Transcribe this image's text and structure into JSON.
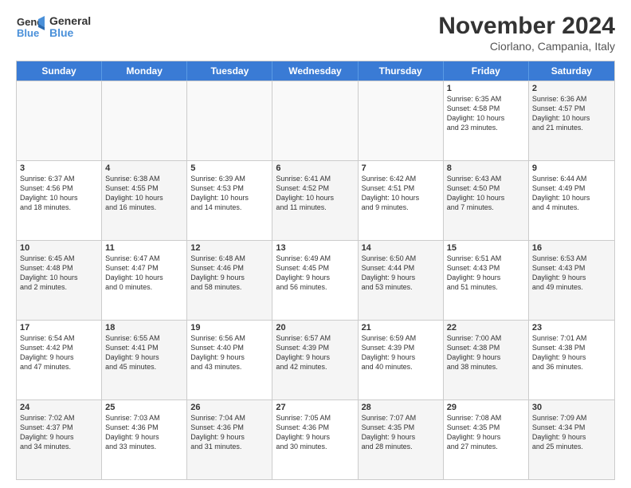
{
  "logo": {
    "text_general": "General",
    "text_blue": "Blue"
  },
  "title": "November 2024",
  "subtitle": "Ciorlano, Campania, Italy",
  "headers": [
    "Sunday",
    "Monday",
    "Tuesday",
    "Wednesday",
    "Thursday",
    "Friday",
    "Saturday"
  ],
  "rows": [
    [
      {
        "day": "",
        "info": "",
        "empty": true
      },
      {
        "day": "",
        "info": "",
        "empty": true
      },
      {
        "day": "",
        "info": "",
        "empty": true
      },
      {
        "day": "",
        "info": "",
        "empty": true
      },
      {
        "day": "",
        "info": "",
        "empty": true
      },
      {
        "day": "1",
        "info": "Sunrise: 6:35 AM\nSunset: 4:58 PM\nDaylight: 10 hours\nand 23 minutes."
      },
      {
        "day": "2",
        "info": "Sunrise: 6:36 AM\nSunset: 4:57 PM\nDaylight: 10 hours\nand 21 minutes.",
        "shaded": true
      }
    ],
    [
      {
        "day": "3",
        "info": "Sunrise: 6:37 AM\nSunset: 4:56 PM\nDaylight: 10 hours\nand 18 minutes."
      },
      {
        "day": "4",
        "info": "Sunrise: 6:38 AM\nSunset: 4:55 PM\nDaylight: 10 hours\nand 16 minutes.",
        "shaded": true
      },
      {
        "day": "5",
        "info": "Sunrise: 6:39 AM\nSunset: 4:53 PM\nDaylight: 10 hours\nand 14 minutes."
      },
      {
        "day": "6",
        "info": "Sunrise: 6:41 AM\nSunset: 4:52 PM\nDaylight: 10 hours\nand 11 minutes.",
        "shaded": true
      },
      {
        "day": "7",
        "info": "Sunrise: 6:42 AM\nSunset: 4:51 PM\nDaylight: 10 hours\nand 9 minutes."
      },
      {
        "day": "8",
        "info": "Sunrise: 6:43 AM\nSunset: 4:50 PM\nDaylight: 10 hours\nand 7 minutes.",
        "shaded": true
      },
      {
        "day": "9",
        "info": "Sunrise: 6:44 AM\nSunset: 4:49 PM\nDaylight: 10 hours\nand 4 minutes."
      }
    ],
    [
      {
        "day": "10",
        "info": "Sunrise: 6:45 AM\nSunset: 4:48 PM\nDaylight: 10 hours\nand 2 minutes.",
        "shaded": true
      },
      {
        "day": "11",
        "info": "Sunrise: 6:47 AM\nSunset: 4:47 PM\nDaylight: 10 hours\nand 0 minutes."
      },
      {
        "day": "12",
        "info": "Sunrise: 6:48 AM\nSunset: 4:46 PM\nDaylight: 9 hours\nand 58 minutes.",
        "shaded": true
      },
      {
        "day": "13",
        "info": "Sunrise: 6:49 AM\nSunset: 4:45 PM\nDaylight: 9 hours\nand 56 minutes."
      },
      {
        "day": "14",
        "info": "Sunrise: 6:50 AM\nSunset: 4:44 PM\nDaylight: 9 hours\nand 53 minutes.",
        "shaded": true
      },
      {
        "day": "15",
        "info": "Sunrise: 6:51 AM\nSunset: 4:43 PM\nDaylight: 9 hours\nand 51 minutes."
      },
      {
        "day": "16",
        "info": "Sunrise: 6:53 AM\nSunset: 4:43 PM\nDaylight: 9 hours\nand 49 minutes.",
        "shaded": true
      }
    ],
    [
      {
        "day": "17",
        "info": "Sunrise: 6:54 AM\nSunset: 4:42 PM\nDaylight: 9 hours\nand 47 minutes."
      },
      {
        "day": "18",
        "info": "Sunrise: 6:55 AM\nSunset: 4:41 PM\nDaylight: 9 hours\nand 45 minutes.",
        "shaded": true
      },
      {
        "day": "19",
        "info": "Sunrise: 6:56 AM\nSunset: 4:40 PM\nDaylight: 9 hours\nand 43 minutes."
      },
      {
        "day": "20",
        "info": "Sunrise: 6:57 AM\nSunset: 4:39 PM\nDaylight: 9 hours\nand 42 minutes.",
        "shaded": true
      },
      {
        "day": "21",
        "info": "Sunrise: 6:59 AM\nSunset: 4:39 PM\nDaylight: 9 hours\nand 40 minutes."
      },
      {
        "day": "22",
        "info": "Sunrise: 7:00 AM\nSunset: 4:38 PM\nDaylight: 9 hours\nand 38 minutes.",
        "shaded": true
      },
      {
        "day": "23",
        "info": "Sunrise: 7:01 AM\nSunset: 4:38 PM\nDaylight: 9 hours\nand 36 minutes."
      }
    ],
    [
      {
        "day": "24",
        "info": "Sunrise: 7:02 AM\nSunset: 4:37 PM\nDaylight: 9 hours\nand 34 minutes.",
        "shaded": true
      },
      {
        "day": "25",
        "info": "Sunrise: 7:03 AM\nSunset: 4:36 PM\nDaylight: 9 hours\nand 33 minutes."
      },
      {
        "day": "26",
        "info": "Sunrise: 7:04 AM\nSunset: 4:36 PM\nDaylight: 9 hours\nand 31 minutes.",
        "shaded": true
      },
      {
        "day": "27",
        "info": "Sunrise: 7:05 AM\nSunset: 4:36 PM\nDaylight: 9 hours\nand 30 minutes."
      },
      {
        "day": "28",
        "info": "Sunrise: 7:07 AM\nSunset: 4:35 PM\nDaylight: 9 hours\nand 28 minutes.",
        "shaded": true
      },
      {
        "day": "29",
        "info": "Sunrise: 7:08 AM\nSunset: 4:35 PM\nDaylight: 9 hours\nand 27 minutes."
      },
      {
        "day": "30",
        "info": "Sunrise: 7:09 AM\nSunset: 4:34 PM\nDaylight: 9 hours\nand 25 minutes.",
        "shaded": true
      }
    ]
  ]
}
